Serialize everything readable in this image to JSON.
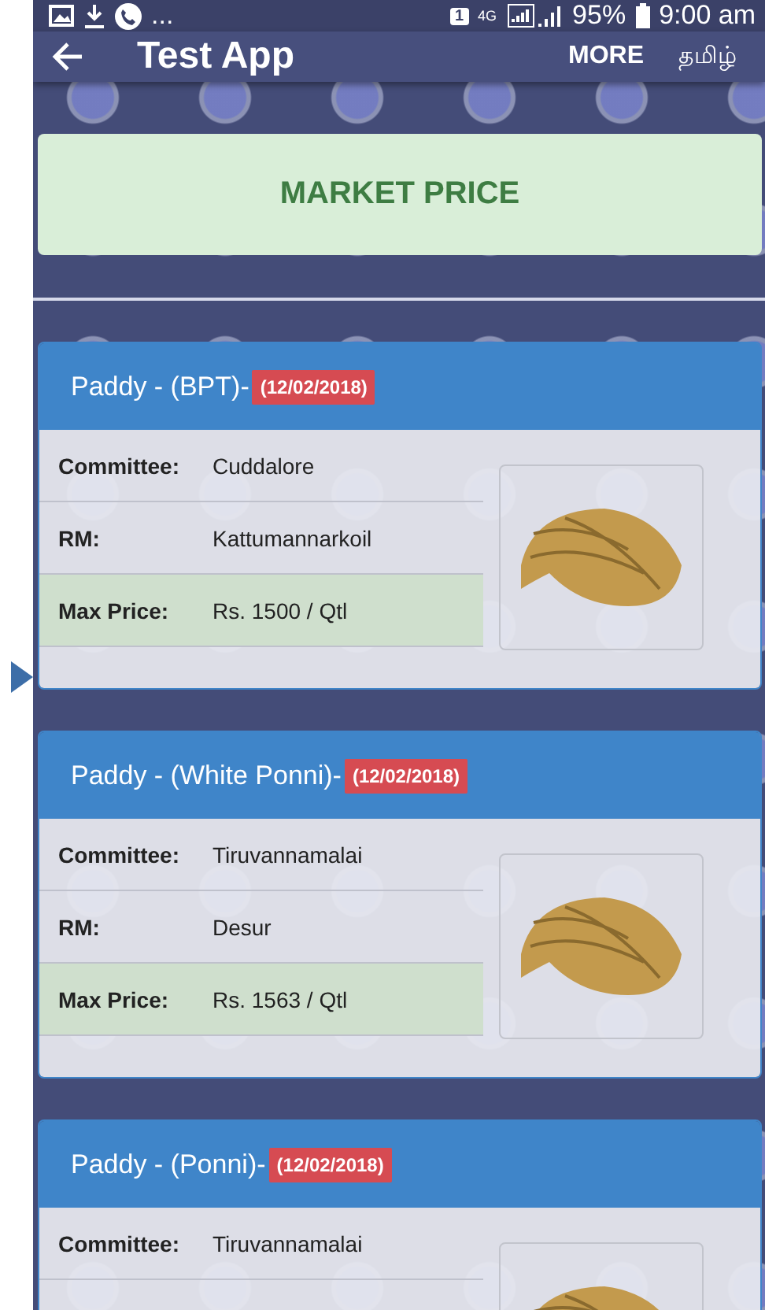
{
  "status_bar": {
    "notification_more": "...",
    "sim_badge": "1",
    "network": "4G",
    "battery": "95%",
    "time": "9:00 am"
  },
  "toolbar": {
    "title": "Test App",
    "actions": [
      "MORE",
      "தமிழ்"
    ]
  },
  "banner": {
    "title": "MARKET PRICE"
  },
  "cards": [
    {
      "title": "Paddy - (BPT)-",
      "date": "(12/02/2018)",
      "rows": [
        {
          "label": "Committee:",
          "value": "Cuddalore",
          "highlighted": false
        },
        {
          "label": "RM:",
          "value": "Kattumannarkoil",
          "highlighted": false
        },
        {
          "label": "Max Price:",
          "value": "Rs. 1500 / Qtl",
          "highlighted": true
        }
      ]
    },
    {
      "title": "Paddy - (White Ponni)-",
      "date": "(12/02/2018)",
      "rows": [
        {
          "label": "Committee:",
          "value": "Tiruvannamalai",
          "highlighted": false
        },
        {
          "label": "RM:",
          "value": "Desur",
          "highlighted": false
        },
        {
          "label": "Max Price:",
          "value": "Rs. 1563 / Qtl",
          "highlighted": true
        }
      ]
    },
    {
      "title": "Paddy - (Ponni)-",
      "date": "(12/02/2018)",
      "rows": [
        {
          "label": "Committee:",
          "value": "Tiruvannamalai",
          "highlighted": false
        }
      ]
    }
  ]
}
